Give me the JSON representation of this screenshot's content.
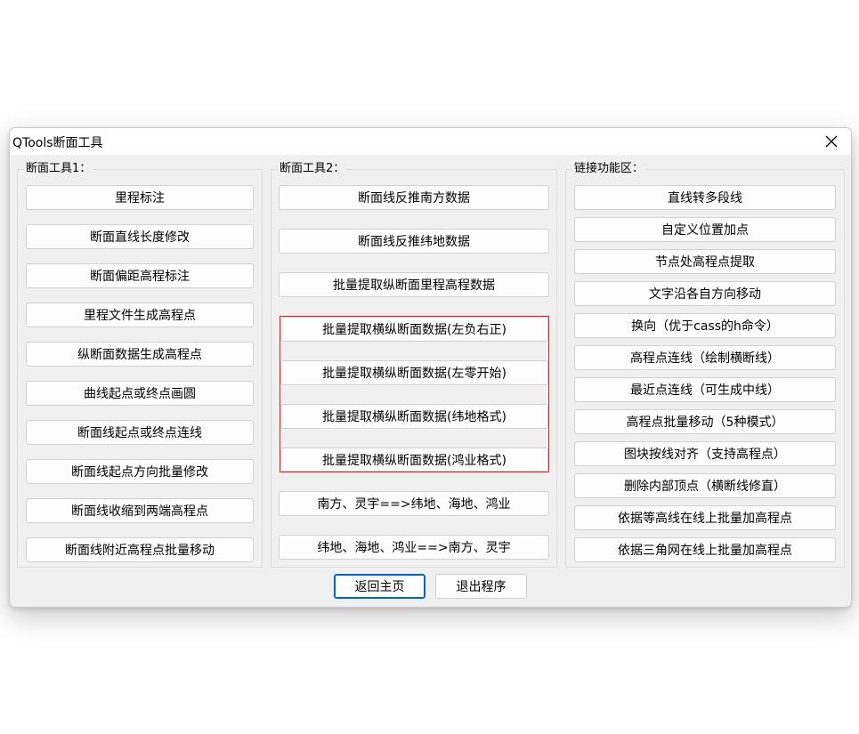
{
  "window": {
    "title": "QTools断面工具"
  },
  "groups": {
    "g1": {
      "label": "断面工具1：",
      "buttons": [
        "里程标注",
        "断面直线长度修改",
        "断面偏距高程标注",
        "里程文件生成高程点",
        "纵断面数据生成高程点",
        "曲线起点或终点画圆",
        "断面线起点或终点连线",
        "断面线起点方向批量修改",
        "断面线收缩到两端高程点",
        "断面线附近高程点批量移动"
      ]
    },
    "g2": {
      "label": "断面工具2：",
      "buttons": [
        "断面线反推南方数据",
        "断面线反推纬地数据",
        "批量提取纵断面里程高程数据",
        "批量提取横纵断面数据(左负右正)",
        "批量提取横纵断面数据(左零开始)",
        "批量提取横纵断面数据(纬地格式)",
        "批量提取横纵断面数据(鸿业格式)",
        "南方、灵宇==>纬地、海地、鸿业",
        "纬地、海地、鸿业==>南方、灵宇"
      ]
    },
    "g3": {
      "label": "链接功能区：",
      "buttons": [
        "直线转多段线",
        "自定义位置加点",
        "节点处高程点提取",
        "文字沿各自方向移动",
        "换向（优于cass的h命令）",
        "高程点连线（绘制横断线）",
        "最近点连线（可生成中线）",
        "高程点批量移动（5种模式）",
        "图块按线对齐（支持高程点）",
        "删除内部顶点（横断线修直）",
        "依据等高线在线上批量加高程点",
        "依据三角网在线上批量加高程点"
      ]
    }
  },
  "footer": {
    "back_label": "返回主页",
    "exit_label": "退出程序"
  },
  "colors": {
    "highlight_border": "#e02020",
    "focus_border": "#0067c0"
  }
}
